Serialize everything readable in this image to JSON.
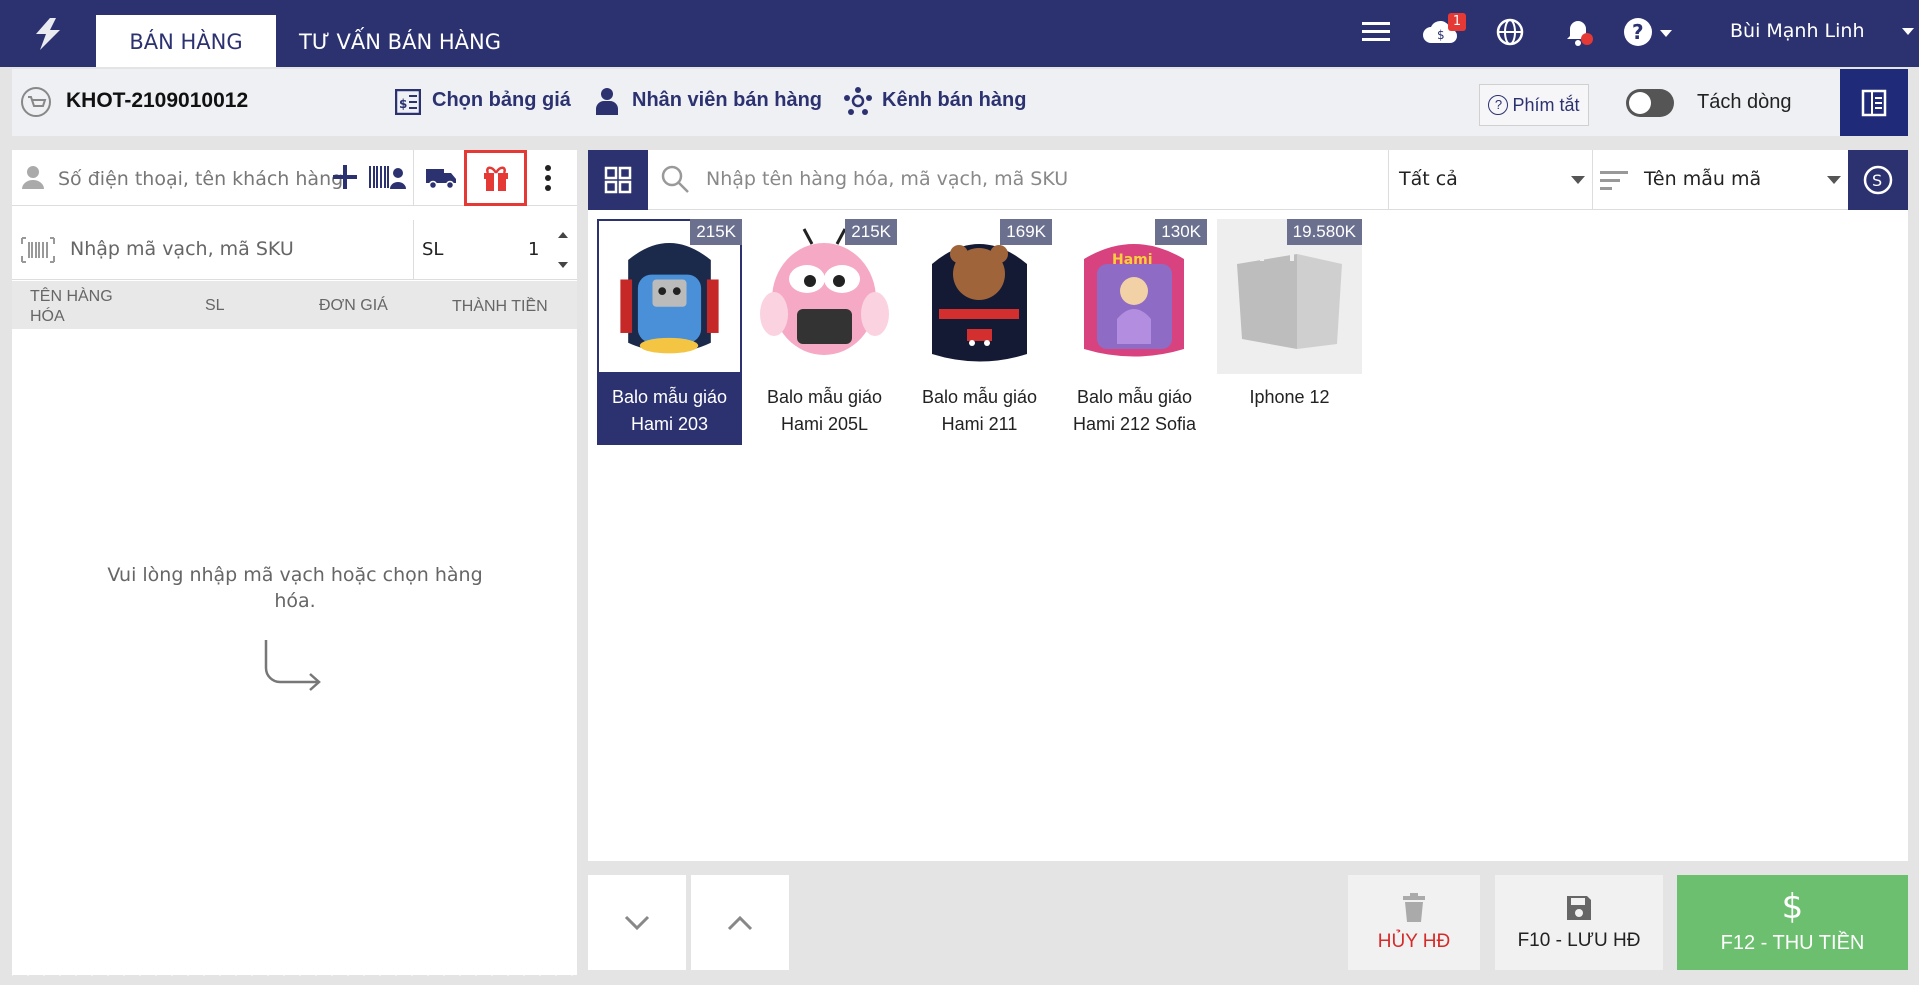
{
  "header": {
    "tabs": [
      {
        "label": "BÁN HÀNG",
        "active": true
      },
      {
        "label": "TƯ VẤN BÁN HÀNG",
        "active": false
      }
    ],
    "notification_count": "1",
    "user_name": "Bùi Mạnh Linh",
    "brand_color": "#2c3270"
  },
  "infobar": {
    "order_code": "KHOT-2109010012",
    "price_table_label": "Chọn bảng giá",
    "sales_staff_label": "Nhân viên bán hàng",
    "channel_label": "Kênh bán hàng",
    "shortcut_label": "Phím tắt",
    "split_line_label": "Tách dòng",
    "split_line_on": false
  },
  "cart": {
    "customer_placeholder": "Số điện thoại, tên khách hàng",
    "sku_placeholder": "Nhập mã vạch, mã SKU",
    "qty_label": "SL",
    "qty_value": "1",
    "columns": {
      "name": "TÊN HÀNG HÓA",
      "qty": "SL",
      "unit_price": "ĐƠN GIÁ",
      "total": "THÀNH TIỀN"
    },
    "empty_message": "Vui lòng nhập mã vạch hoặc chọn hàng hóa."
  },
  "catalog": {
    "search_placeholder": "Nhập tên hàng hóa, mã vạch, mã SKU",
    "category_filter": "Tất cả",
    "sort_filter": "Tên mẫu mã",
    "products": [
      {
        "name": "Balo mẫu giáo Hami 203",
        "price": "215K",
        "selected": true
      },
      {
        "name": "Balo mẫu giáo Hami 205L",
        "price": "215K",
        "selected": false
      },
      {
        "name": "Balo mẫu giáo Hami 211",
        "price": "169K",
        "selected": false
      },
      {
        "name": "Balo mẫu giáo Hami 212 Sofia",
        "price": "130K",
        "selected": false
      },
      {
        "name": "Iphone 12",
        "price": "19.580K",
        "selected": false
      }
    ]
  },
  "actions": {
    "cancel_label": "HỦY HĐ",
    "save_label": "F10 - LƯU HĐ",
    "pay_label": "F12 - THU TIỀN",
    "pay_color": "#6bbf6e",
    "cancel_color": "#d52b2b"
  }
}
